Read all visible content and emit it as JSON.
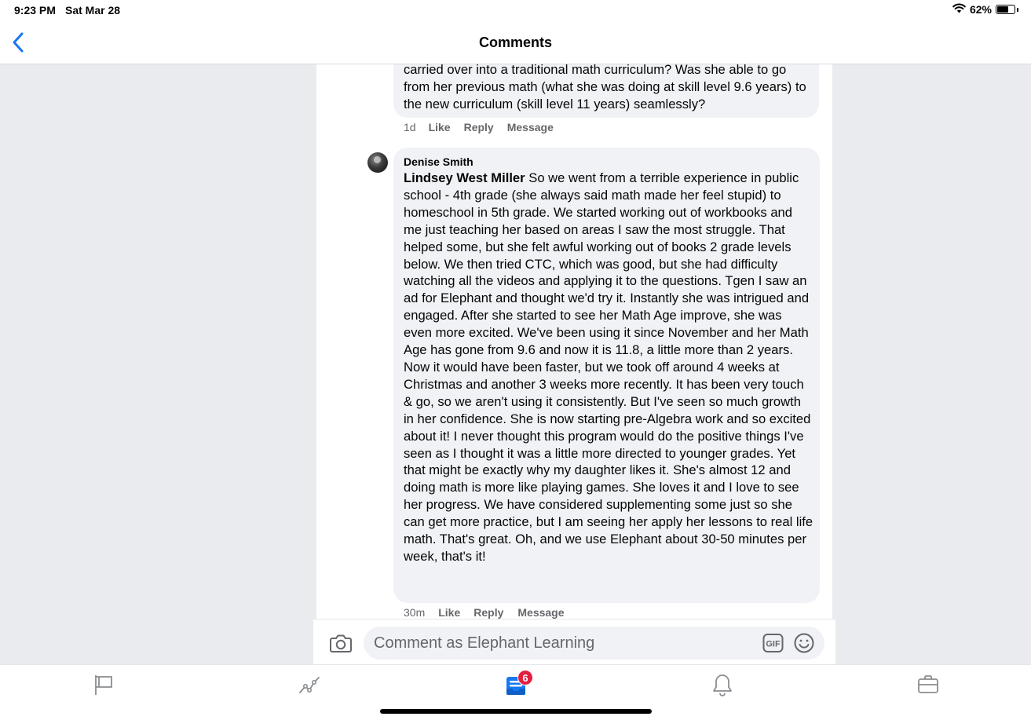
{
  "status_bar": {
    "time": "9:23 PM",
    "date": "Sat Mar 28",
    "battery_percent": "62%",
    "battery_level": 0.62
  },
  "nav": {
    "title": "Comments",
    "back_icon": "chevron-left-icon"
  },
  "comments": [
    {
      "text": "carried over into a traditional math curriculum? Was she able to go from her previous math (what she was doing at skill level 9.6 years) to the new curriculum (skill level 11 years) seamlessly?",
      "actions": {
        "time": "1d",
        "like": "Like",
        "reply": "Reply",
        "message": "Message"
      }
    },
    {
      "author": "Denise Smith",
      "mention": "Lindsey West Miller",
      "text": "So we went from a terrible experience in public school - 4th grade (she always said math made her feel stupid) to homeschool in 5th grade. We started working out of workbooks and me just teaching her based on areas I saw the most struggle. That helped some, but she felt awful working out of books 2 grade levels below. We then tried CTC, which was good, but she had difficulty watching all the videos and applying it to the questions. Tgen I saw an ad for Elephant and thought we'd try it. Instantly she was intrigued and engaged. After she started to see her Math Age improve, she was even more excited. We've been using it since November and her Math Age has gone from 9.6 and now it is 11.8, a little more than 2 years. Now it would have been faster, but we took off around 4 weeks at Christmas and another 3 weeks more recently. It has been very touch & go, so we aren't using it consistently. But I've seen so much growth in her confidence. She is now starting pre-Algebra work and so excited about it! I never thought this program would do the positive things I've seen as I thought it was a little more directed to younger grades. Yet that might be exactly why my daughter likes it. She's almost 12 and doing math is more like playing games. She loves it and I love to see her progress. We have considered supplementing some just so she can get more practice, but I am seeing her apply her lessons to real life math. That's great. Oh, and we use Elephant about 30-50 minutes per week, that's it!",
      "actions": {
        "time": "30m",
        "like": "Like",
        "reply": "Reply",
        "message": "Message"
      }
    }
  ],
  "composer": {
    "placeholder": "Comment as Elephant Learning",
    "camera_icon": "camera-icon",
    "gif_label": "GIF",
    "emoji_icon": "smiley-icon"
  },
  "tab_bar": {
    "tabs": [
      "flag-icon",
      "activity-icon",
      "feed-icon",
      "bell-icon",
      "briefcase-icon"
    ],
    "active": "feed-icon",
    "badge_count": "6"
  },
  "colors": {
    "accent": "#1877f2",
    "bubble": "#f0f2f5",
    "page_bg": "#e9ebee",
    "badge": "#e41e3f",
    "secondary_text": "#65676b"
  }
}
